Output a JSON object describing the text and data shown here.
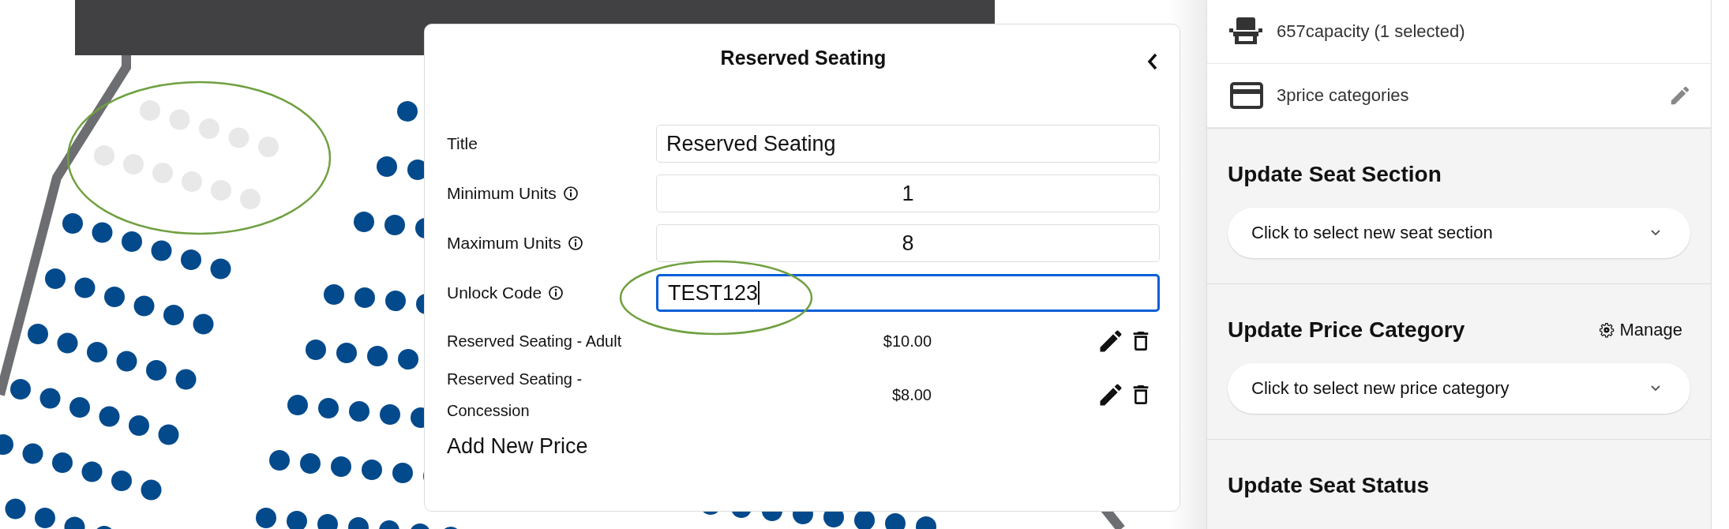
{
  "modal": {
    "title": "Reserved Seating",
    "fields": [
      {
        "label": "Title",
        "value": "Reserved Seating",
        "kind": "text",
        "info": false,
        "focused": false
      },
      {
        "label": "Minimum Units",
        "value": "1",
        "kind": "number",
        "info": true,
        "focused": false
      },
      {
        "label": "Maximum Units",
        "value": "8",
        "kind": "number",
        "info": true,
        "focused": false
      },
      {
        "label": "Unlock Code",
        "value": "TEST123",
        "kind": "text",
        "info": true,
        "focused": true
      }
    ],
    "prices": [
      {
        "name": "Reserved Seating - Adult",
        "amount": "$10.00"
      },
      {
        "name": "Reserved Seating - Concession",
        "amount": "$8.00"
      }
    ],
    "add_price": "Add New Price"
  },
  "summary": {
    "capacity": "657capacity (1 selected)",
    "price_categories": "3price categories"
  },
  "sections": [
    {
      "title": "Update Seat Section",
      "placeholder": "Click to select new seat section"
    },
    {
      "title": "Update Price Category",
      "action": "Manage",
      "placeholder": "Click to select new price category"
    },
    {
      "title": "Update Seat Status"
    }
  ]
}
